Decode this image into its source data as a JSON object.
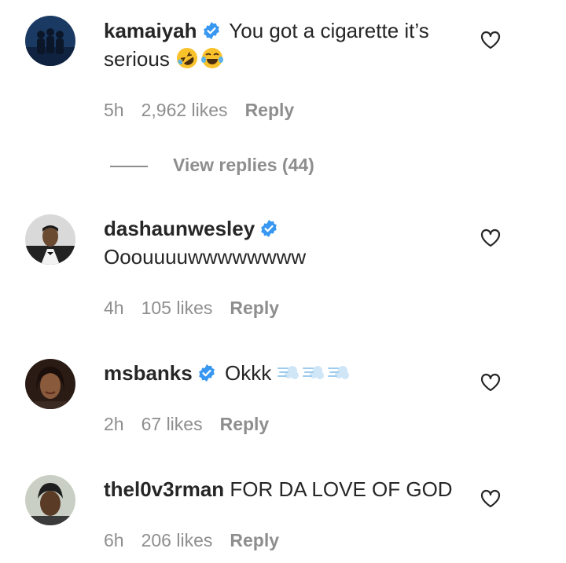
{
  "comments": [
    {
      "username": "kamaiyah",
      "verified": true,
      "text": "You got a cigarette it’s serious",
      "emojis": [
        "rolling-on-floor-laughing",
        "tears-of-joy"
      ],
      "time": "5h",
      "likes": "2,962 likes",
      "reply": "Reply"
    },
    {
      "username": "dashaunwesley",
      "verified": true,
      "text": "Ooouuuuwwwwwwww",
      "time": "4h",
      "likes": "105 likes",
      "reply": "Reply"
    },
    {
      "username": "msbanks",
      "verified": true,
      "text": "Okkk",
      "emojis": [
        "dashing-away",
        "dashing-away",
        "dashing-away"
      ],
      "time": "2h",
      "likes": "67 likes",
      "reply": "Reply"
    },
    {
      "username": "thel0v3rman",
      "verified": false,
      "text": "FOR DA LOVE OF GOD",
      "time": "6h",
      "likes": "206 likes",
      "reply": "Reply"
    }
  ],
  "view_replies": "View replies (44)",
  "colors": {
    "text": "#262626",
    "secondary": "#8e8e8e",
    "verified_blue": "#3897f0"
  },
  "icons": {
    "verified": "verified-badge-icon",
    "like": "heart-outline-icon"
  }
}
